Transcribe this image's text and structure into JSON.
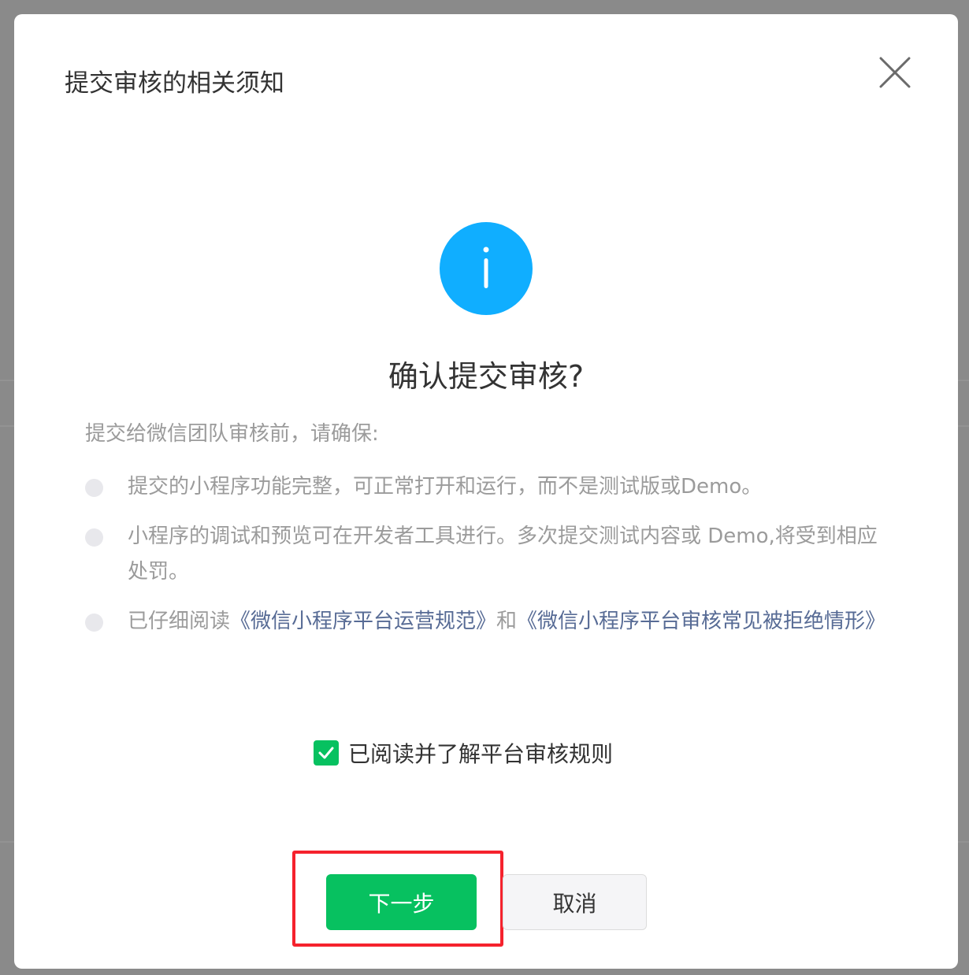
{
  "dialog": {
    "title": "提交审核的相关须知",
    "close_icon": "close-icon",
    "info_icon": "info-icon",
    "heading": "确认提交审核?",
    "intro": "提交给微信团队审核前，请确保:",
    "bullets": [
      {
        "text": "提交的小程序功能完整，可正常打开和运行，而不是测试版或Demo。"
      },
      {
        "text": "小程序的调试和预览可在开发者工具进行。多次提交测试内容或 Demo,将受到相应处罚。"
      },
      {
        "prefix": "已仔细阅读",
        "link1": "《微信小程序平台运营规范》",
        "middle": "和",
        "link2": "《微信小程序平台审核常见被拒绝情形》"
      }
    ],
    "checkbox": {
      "label": "已阅读并了解平台审核规则",
      "checked": true,
      "icon": "check-icon"
    },
    "buttons": {
      "next": "下一步",
      "cancel": "取消"
    }
  },
  "colors": {
    "primary_green": "#07c160",
    "info_blue": "#10aeff",
    "link_blue": "#576b95",
    "highlight_red": "#f5222d"
  }
}
